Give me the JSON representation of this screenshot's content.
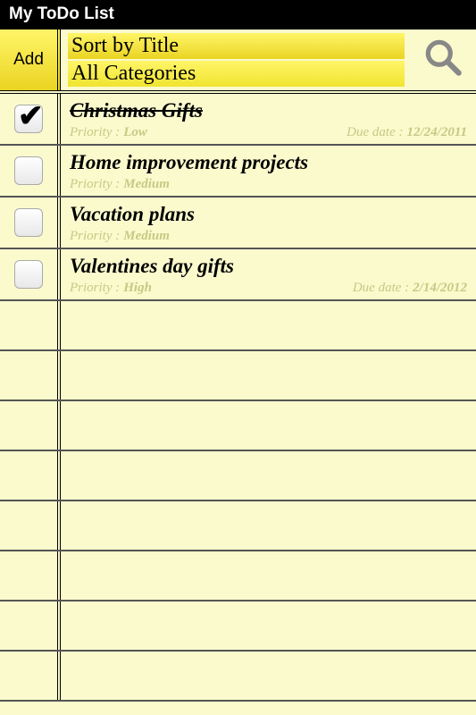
{
  "app": {
    "title": "My ToDo List"
  },
  "toolbar": {
    "add_label": "Add",
    "sort_label": "Sort by Title",
    "filter_label": "All Categories"
  },
  "tasks": [
    {
      "title": "Christmas Gifts",
      "checked": true,
      "priority_label": "Priority :",
      "priority_value": "Low",
      "due_label": "Due date :",
      "due_value": "12/24/2011"
    },
    {
      "title": "Home improvement projects",
      "checked": false,
      "priority_label": "Priority :",
      "priority_value": "Medium",
      "due_label": "",
      "due_value": ""
    },
    {
      "title": "Vacation plans",
      "checked": false,
      "priority_label": "Priority :",
      "priority_value": "Medium",
      "due_label": "",
      "due_value": ""
    },
    {
      "title": "Valentines day gifts",
      "checked": false,
      "priority_label": "Priority :",
      "priority_value": "High",
      "due_label": "Due date :",
      "due_value": "2/14/2012"
    }
  ]
}
